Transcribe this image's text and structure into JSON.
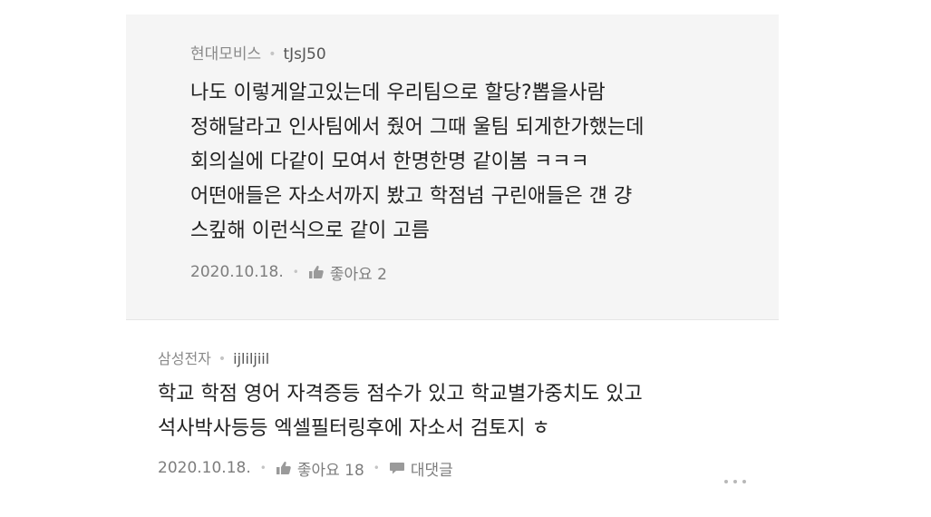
{
  "reply_comment": {
    "company": "현대모비스",
    "username": "tJsJ50",
    "lines": [
      "나도 이렇게알고있는데 우리팀으로 할당?뽑을사람",
      "정해달라고 인사팀에서 줬어 그때 울팀 되게한가했는데",
      "회의실에 다같이 모여서 한명한명 같이봄 ㅋㅋㅋ",
      "어떤애들은 자소서까지 봤고 학점넘 구린애들은 걘 걍",
      "스킾해 이런식으로 같이 고름"
    ],
    "date": "2020.10.18.",
    "like_label": "좋아요 2",
    "like_icon": "thumbs-up-icon"
  },
  "main_comment": {
    "company": "삼성전자",
    "username": "ijliljiil",
    "lines": [
      "학교 학점 영어 자격증등 점수가 있고 학교별가중치도 있고",
      "석사박사등등 엑셀필터링후에 자소서 검토지 ㅎ"
    ],
    "date": "2020.10.18.",
    "like_label": "좋아요 18",
    "reply_label": "대댓글",
    "like_icon": "thumbs-up-icon",
    "reply_icon": "speech-bubble-icon",
    "more_icon": "more-dots-icon"
  },
  "colors": {
    "reply_background": "#f5f5f5",
    "text_primary": "#222222",
    "text_meta": "#8a8a8a",
    "separator": "#c4c4c4"
  }
}
